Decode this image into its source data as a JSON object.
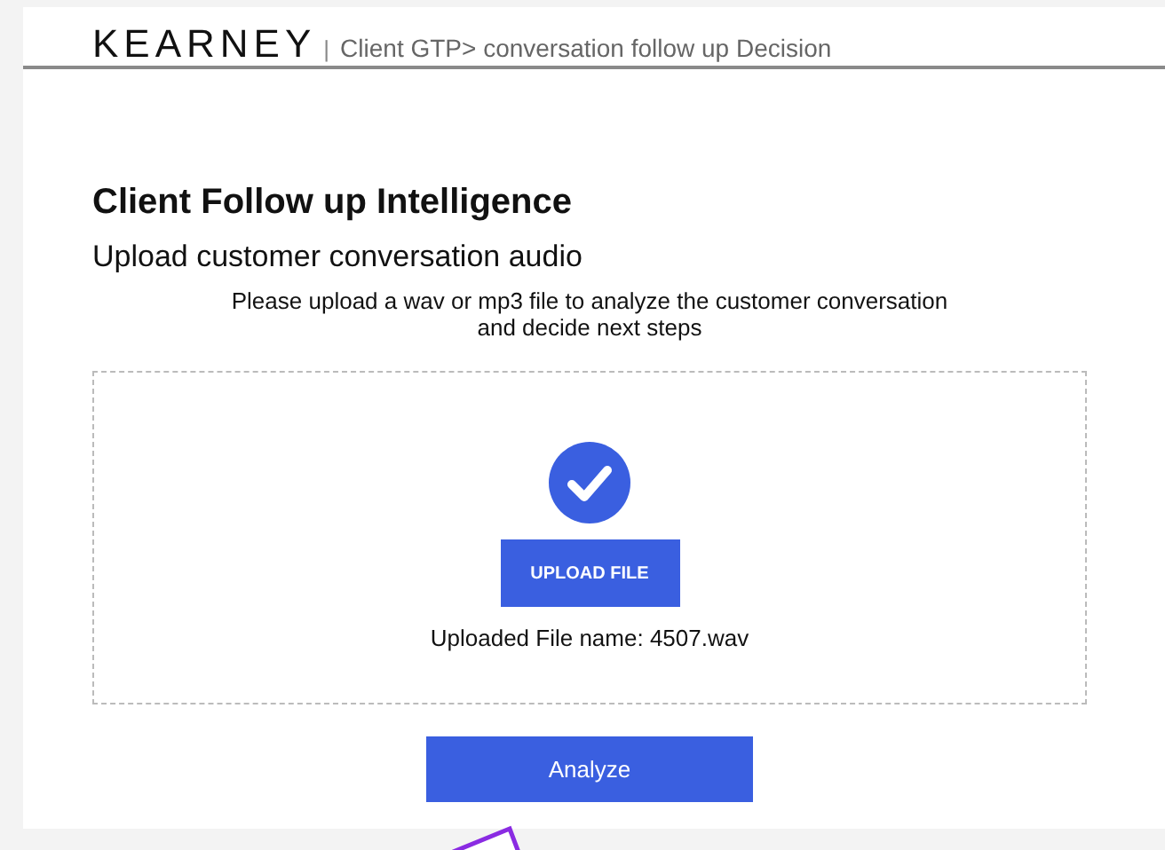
{
  "header": {
    "logo": "KEARNEY",
    "separator": "|",
    "breadcrumb": "Client GTP> conversation follow up Decision"
  },
  "title": "Client Follow up Intelligence",
  "subtitle": "Upload customer conversation audio",
  "instructions": [
    "Please upload a wav or mp3 file to analyze the customer conversation",
    "and decide next steps"
  ],
  "upload": {
    "uploaded": true,
    "button": "UPLOAD FILE",
    "file_label": "Uploaded File name: 4507.wav"
  },
  "analyze_button": "Analyze"
}
